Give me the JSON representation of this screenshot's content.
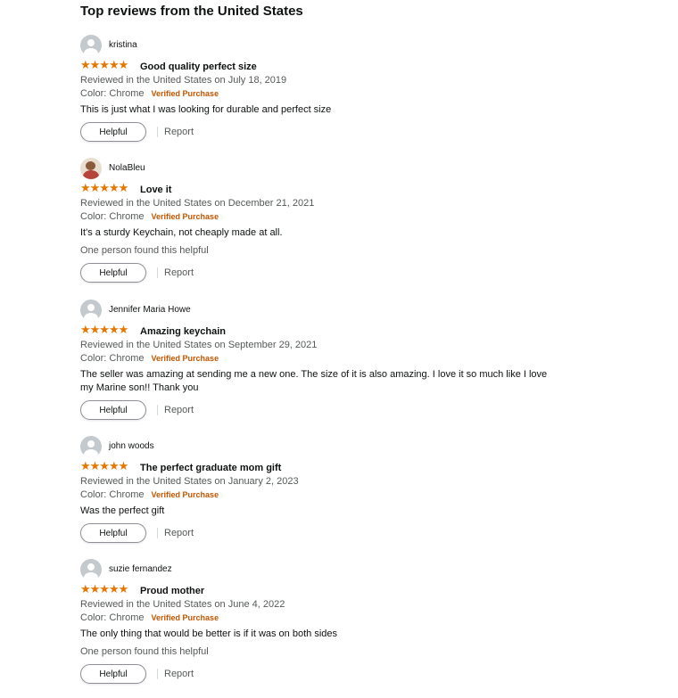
{
  "heading": "Top reviews from the United States",
  "colors": {
    "star": "#e77600",
    "verified": "#c45500",
    "muted": "#565959",
    "text": "#0f1111"
  },
  "reviews": [
    {
      "profile_name": "kristina",
      "avatar": "default-avatar-icon",
      "rating": 5,
      "stars": "★★★★★",
      "title": "Good quality perfect size",
      "date": "Reviewed in the United States on July 18, 2019",
      "variant": "Color: Chrome",
      "verified": "Verified Purchase",
      "body": "This is just what I was looking for durable and perfect size",
      "found_helpful": "",
      "helpful_label": "Helpful",
      "report_label": "Report"
    },
    {
      "profile_name": "NolaBleu",
      "avatar": "photo-avatar",
      "rating": 5,
      "stars": "★★★★★",
      "title": "Love it",
      "date": "Reviewed in the United States on December 21, 2021",
      "variant": "Color: Chrome",
      "verified": "Verified Purchase",
      "body": "It's a sturdy Keychain, not cheaply made at all.",
      "found_helpful": "One person found this helpful",
      "helpful_label": "Helpful",
      "report_label": "Report"
    },
    {
      "profile_name": "Jennifer Maria Howe",
      "avatar": "default-avatar-icon",
      "rating": 5,
      "stars": "★★★★★",
      "title": "Amazing keychain",
      "date": "Reviewed in the United States on September 29, 2021",
      "variant": "Color: Chrome",
      "verified": "Verified Purchase",
      "body_lines": [
        "The seller was amazing at sending me a new one. The size of it is also amazing. I love it so much like I love",
        "my Marine son!! Thank you"
      ],
      "found_helpful": "",
      "helpful_label": "Helpful",
      "report_label": "Report"
    },
    {
      "profile_name": "john woods",
      "avatar": "default-avatar-icon",
      "rating": 5,
      "stars": "★★★★★",
      "title": "The perfect graduate mom gift",
      "date": "Reviewed in the United States on January 2, 2023",
      "variant": "Color: Chrome",
      "verified": "Verified Purchase",
      "body": "Was the perfect gift",
      "found_helpful": "",
      "helpful_label": "Helpful",
      "report_label": "Report"
    },
    {
      "profile_name": "suzie fernandez",
      "avatar": "default-avatar-icon",
      "rating": 5,
      "stars": "★★★★★",
      "title": "Proud mother",
      "date": "Reviewed in the United States on June 4, 2022",
      "variant": "Color: Chrome",
      "verified": "Verified Purchase",
      "body": "The only thing that would be better is if it was on both sides",
      "found_helpful": "One person found this helpful",
      "helpful_label": "Helpful",
      "report_label": "Report"
    }
  ]
}
